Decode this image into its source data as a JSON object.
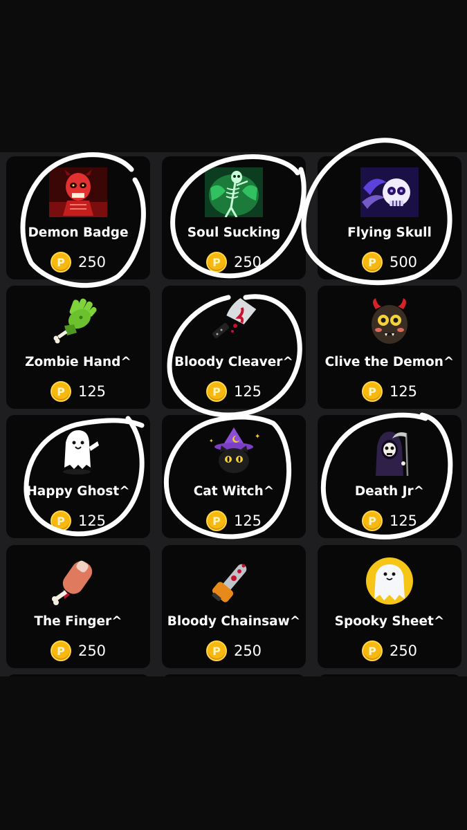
{
  "shop": {
    "currency_icon": "coin-icon",
    "coin_symbol": "P",
    "items": [
      {
        "name": "Demon Badge",
        "price": "250",
        "icon": "demon-skull-icon"
      },
      {
        "name": "Soul Sucking",
        "price": "250",
        "icon": "soul-skeleton-icon"
      },
      {
        "name": "Flying Skull",
        "price": "500",
        "icon": "flying-skull-icon"
      },
      {
        "name": "Zombie Hand^",
        "price": "125",
        "icon": "zombie-hand-icon"
      },
      {
        "name": "Bloody Cleaver^",
        "price": "125",
        "icon": "bloody-cleaver-icon"
      },
      {
        "name": "Clive the Demon^",
        "price": "125",
        "icon": "clive-demon-icon"
      },
      {
        "name": "Happy Ghost^",
        "price": "125",
        "icon": "happy-ghost-icon"
      },
      {
        "name": "Cat Witch^",
        "price": "125",
        "icon": "cat-witch-icon"
      },
      {
        "name": "Death Jr^",
        "price": "125",
        "icon": "grim-reaper-icon"
      },
      {
        "name": "The Finger^",
        "price": "250",
        "icon": "severed-finger-icon"
      },
      {
        "name": "Bloody Chainsaw^",
        "price": "250",
        "icon": "bloody-chainsaw-icon"
      },
      {
        "name": "Spooky Sheet^",
        "price": "250",
        "icon": "spooky-sheet-ghost-icon"
      }
    ]
  },
  "colors": {
    "background": "#0c0c0d",
    "panel": "#1e1e20",
    "card": "#080808",
    "coin": "#f7b90f",
    "text": "#ffffff",
    "annotation": "#ffffff"
  }
}
